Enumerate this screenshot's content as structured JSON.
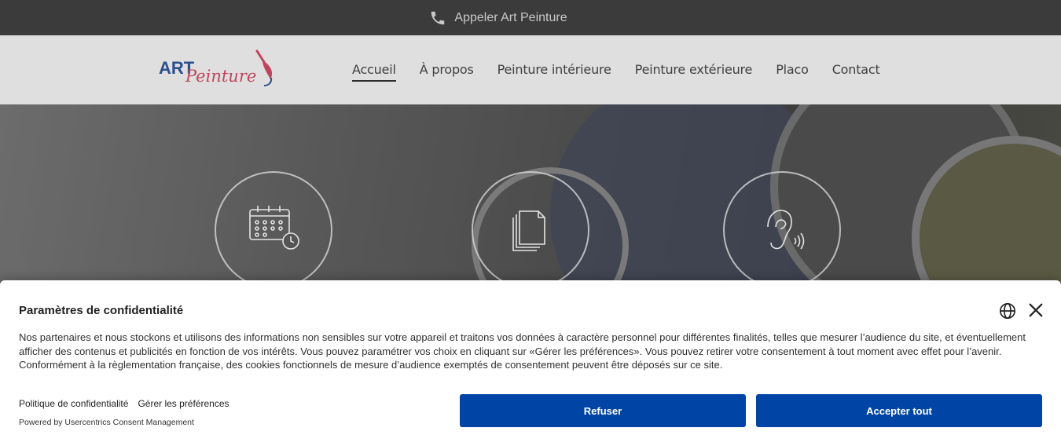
{
  "topbar": {
    "call_label": "Appeler Art Peinture",
    "icon": "phone-icon"
  },
  "header": {
    "logo": {
      "word1": "ART",
      "word2": "Peinture",
      "icon": "paintbrush-icon"
    },
    "nav": [
      {
        "label": "Accueil",
        "active": true
      },
      {
        "label": "À propos"
      },
      {
        "label": "Peinture intérieure"
      },
      {
        "label": "Peinture extérieure"
      },
      {
        "label": "Placo"
      },
      {
        "label": "Contact"
      }
    ]
  },
  "hero": {
    "icons": [
      "calendar-clock-icon",
      "documents-icon",
      "ear-icon"
    ]
  },
  "consent": {
    "title": "Paramètres de confidentialité",
    "body": "Nos partenaires et nous stockons et utilisons des informations non sensibles sur votre appareil et traitons vos données à caractère personnel pour différentes finalités, telles que mesurer l’audience du site, et éventuellement afficher des contenus et publicités en fonction de vos intérêts. Vous pouvez paramétrer vos choix en cliquant sur «Gérer les préférences». Vous pouvez retirer votre consentement à tout moment avec effet pour l’avenir. Conformément à la règlementation française, des cookies fonctionnels de mesure d’audience exemptés de consentement peuvent être déposés sur ce site.",
    "privacy_link": "Politique de confidentialité",
    "prefs_link": "Gérer les préférences",
    "powered": "Powered by Usercentrics Consent Management",
    "refuse_label": "Refuser",
    "accept_label": "Accepter tout",
    "button_color": "#0045a5"
  }
}
